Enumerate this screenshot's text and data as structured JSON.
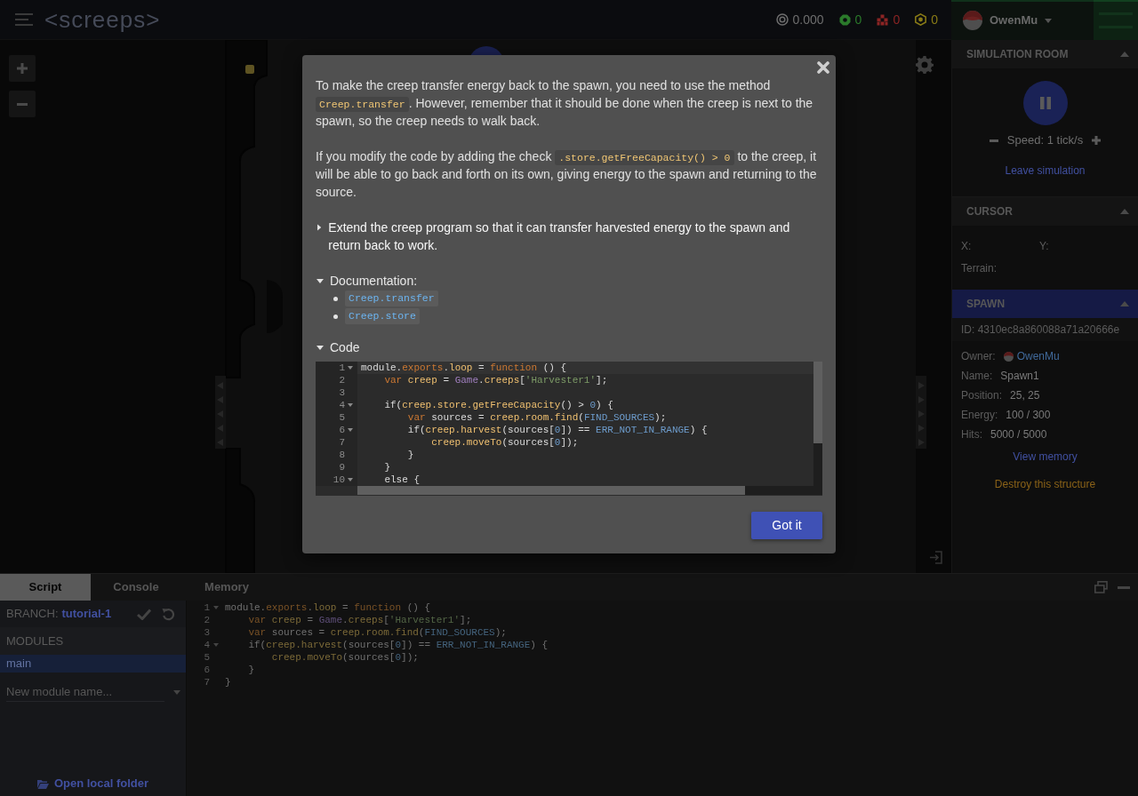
{
  "topbar": {
    "logo": "<screeps>",
    "stats": [
      {
        "kind": "credits",
        "value": "0.000",
        "color": "#6e6e6e"
      },
      {
        "kind": "gcl",
        "value": "0",
        "color": "#2b7a2b"
      },
      {
        "kind": "power",
        "value": "0",
        "color": "#8c2424"
      },
      {
        "kind": "energy",
        "value": "0",
        "color": "#8a7c16"
      }
    ],
    "user": {
      "name": "OwenMu"
    }
  },
  "side_panel": {
    "sections": [
      {
        "kind": "simulation",
        "title": "SIMULATION ROOM",
        "expanded": true,
        "active": false,
        "running": true,
        "speed": "Speed: 1 tick/s",
        "link": "Leave simulation"
      },
      {
        "kind": "cursor",
        "title": "CURSOR",
        "expanded": true,
        "active": false,
        "rows": [
          [
            "X:",
            "Y:"
          ],
          [
            "Terrain:"
          ]
        ]
      },
      {
        "kind": "object",
        "title": "SPAWN",
        "expanded": true,
        "active": true,
        "id": "ID: 4310ec8a860088a71a20666e",
        "fields": [
          {
            "kind": "user",
            "label": "Owner:",
            "value": "OwenMu"
          },
          {
            "kind": "text",
            "label": "Name:",
            "value": "Spawn1"
          },
          {
            "kind": "text",
            "label": "Position:",
            "value": "25, 25"
          },
          {
            "kind": "text",
            "label": "Energy:",
            "value": "100 / 300"
          },
          {
            "kind": "text",
            "label": "Hits:",
            "value": "5000 / 5000"
          }
        ],
        "links": [
          {
            "kind": "normal",
            "text": "View memory"
          },
          {
            "kind": "danger",
            "text": "Destroy this structure"
          }
        ]
      }
    ]
  },
  "bottom_panel": {
    "tabs": [
      {
        "label": "Script",
        "selected": true
      },
      {
        "label": "Console",
        "selected": false
      },
      {
        "label": "Memory",
        "selected": false
      }
    ],
    "branch": {
      "label": "BRANCH:",
      "name": "tutorial-1"
    },
    "modules": {
      "title": "MODULES",
      "items": [
        {
          "name": "main",
          "selected": true
        }
      ],
      "new_module": {
        "placeholder": "New module name..."
      }
    },
    "open_folder": "Open local folder",
    "editor": {
      "lines": [
        {
          "number": "1",
          "fold": true,
          "tokens": [
            {
              "kind": "plain",
              "text": "module."
            },
            {
              "kind": "keyword",
              "text": "exports"
            },
            {
              "kind": "plain",
              "text": "."
            },
            {
              "kind": "prop",
              "text": "loop"
            },
            {
              "kind": "plain",
              "text": " = "
            },
            {
              "kind": "keyword",
              "text": "function"
            },
            {
              "kind": "plain",
              "text": " () {"
            }
          ]
        },
        {
          "number": "2",
          "fold": false,
          "tokens": [
            {
              "kind": "keyword",
              "text": "    var "
            },
            {
              "kind": "prop",
              "text": "creep"
            },
            {
              "kind": "plain",
              "text": " = "
            },
            {
              "kind": "global",
              "text": "Game"
            },
            {
              "kind": "plain",
              "text": "."
            },
            {
              "kind": "prop",
              "text": "creeps"
            },
            {
              "kind": "plain",
              "text": "["
            },
            {
              "kind": "string",
              "text": "'Harvester1'"
            },
            {
              "kind": "plain",
              "text": "];"
            }
          ]
        },
        {
          "number": "3",
          "fold": false,
          "tokens": [
            {
              "kind": "keyword",
              "text": "    var"
            },
            {
              "kind": "plain",
              "text": " sources = "
            },
            {
              "kind": "prop",
              "text": "creep.room.find"
            },
            {
              "kind": "plain",
              "text": "("
            },
            {
              "kind": "const",
              "text": "FIND_SOURCES"
            },
            {
              "kind": "plain",
              "text": ");"
            }
          ]
        },
        {
          "number": "4",
          "fold": true,
          "tokens": [
            {
              "kind": "plain",
              "text": "    if("
            },
            {
              "kind": "prop",
              "text": "creep.harvest"
            },
            {
              "kind": "plain",
              "text": "(sources["
            },
            {
              "kind": "const",
              "text": "0"
            },
            {
              "kind": "plain",
              "text": "]) == "
            },
            {
              "kind": "const",
              "text": "ERR_NOT_IN_RANGE"
            },
            {
              "kind": "plain",
              "text": ") {"
            }
          ]
        },
        {
          "number": "5",
          "fold": false,
          "tokens": [
            {
              "kind": "prop",
              "text": "        creep.moveTo"
            },
            {
              "kind": "plain",
              "text": "(sources["
            },
            {
              "kind": "const",
              "text": "0"
            },
            {
              "kind": "plain",
              "text": "]);"
            }
          ]
        },
        {
          "number": "6",
          "fold": false,
          "tokens": [
            {
              "kind": "plain",
              "text": "    }"
            }
          ]
        },
        {
          "number": "7",
          "fold": false,
          "tokens": [
            {
              "kind": "plain",
              "text": "}"
            }
          ]
        }
      ]
    }
  },
  "modal": {
    "paragraphs": [
      [
        {
          "kind": "text",
          "text": "To make the creep transfer energy back to the spawn, you need to use the method "
        },
        {
          "kind": "code",
          "text": "Creep.transfer"
        },
        {
          "kind": "text",
          "text": ". However, remember that it should be done when the creep is next to the spawn, so the creep needs to walk back."
        }
      ],
      [
        {
          "kind": "text",
          "text": "If you modify the code by adding the check "
        },
        {
          "kind": "code",
          "text": ".store.getFreeCapacity() > 0"
        },
        {
          "kind": "text",
          "text": " to the creep, it will be able to go back and forth on its own, giving energy to the spawn and returning to the source."
        }
      ]
    ],
    "sections": [
      {
        "kind": "task",
        "label": "Extend the creep program so that it can transfer harvested energy to the spawn and return back to work.",
        "expanded": false
      },
      {
        "kind": "links",
        "label": "Documentation:",
        "expanded": true,
        "links": [
          "Creep.transfer",
          "Creep.store"
        ]
      },
      {
        "kind": "code",
        "label": "Code",
        "expanded": true,
        "lines": [
          {
            "number": "1",
            "fold": true,
            "current": true,
            "tokens": [
              {
                "kind": "plain",
                "text": "module."
              },
              {
                "kind": "keyword",
                "text": "exports"
              },
              {
                "kind": "plain",
                "text": "."
              },
              {
                "kind": "prop",
                "text": "loop"
              },
              {
                "kind": "plain",
                "text": " = "
              },
              {
                "kind": "keyword",
                "text": "function"
              },
              {
                "kind": "plain",
                "text": " () {"
              }
            ]
          },
          {
            "number": "2",
            "fold": false,
            "current": false,
            "tokens": [
              {
                "kind": "keyword",
                "text": "    var "
              },
              {
                "kind": "prop",
                "text": "creep"
              },
              {
                "kind": "plain",
                "text": " = "
              },
              {
                "kind": "global",
                "text": "Game"
              },
              {
                "kind": "plain",
                "text": "."
              },
              {
                "kind": "prop",
                "text": "creeps"
              },
              {
                "kind": "plain",
                "text": "["
              },
              {
                "kind": "string",
                "text": "'Harvester1'"
              },
              {
                "kind": "plain",
                "text": "];"
              }
            ]
          },
          {
            "number": "3",
            "fold": false,
            "current": false
          },
          {
            "number": "4",
            "fold": true,
            "current": false,
            "tokens": [
              {
                "kind": "plain",
                "text": "    if("
              },
              {
                "kind": "prop",
                "text": "creep.store.getFreeCapacity"
              },
              {
                "kind": "plain",
                "text": "() > "
              },
              {
                "kind": "const",
                "text": "0"
              },
              {
                "kind": "plain",
                "text": ") {"
              }
            ]
          },
          {
            "number": "5",
            "fold": false,
            "current": false,
            "tokens": [
              {
                "kind": "keyword",
                "text": "        var"
              },
              {
                "kind": "plain",
                "text": " sources = "
              },
              {
                "kind": "prop",
                "text": "creep.room.find"
              },
              {
                "kind": "plain",
                "text": "("
              },
              {
                "kind": "const",
                "text": "FIND_SOURCES"
              },
              {
                "kind": "plain",
                "text": ");"
              }
            ]
          },
          {
            "number": "6",
            "fold": true,
            "current": false,
            "tokens": [
              {
                "kind": "plain",
                "text": "        if("
              },
              {
                "kind": "prop",
                "text": "creep.harvest"
              },
              {
                "kind": "plain",
                "text": "(sources["
              },
              {
                "kind": "const",
                "text": "0"
              },
              {
                "kind": "plain",
                "text": "]) == "
              },
              {
                "kind": "const",
                "text": "ERR_NOT_IN_RANGE"
              },
              {
                "kind": "plain",
                "text": ") {"
              }
            ]
          },
          {
            "number": "7",
            "fold": false,
            "current": false,
            "tokens": [
              {
                "kind": "prop",
                "text": "            creep.moveTo"
              },
              {
                "kind": "plain",
                "text": "(sources["
              },
              {
                "kind": "const",
                "text": "0"
              },
              {
                "kind": "plain",
                "text": "]);"
              }
            ]
          },
          {
            "number": "8",
            "fold": false,
            "current": false,
            "tokens": [
              {
                "kind": "plain",
                "text": "        }"
              }
            ]
          },
          {
            "number": "9",
            "fold": false,
            "current": false,
            "tokens": [
              {
                "kind": "plain",
                "text": "    }"
              }
            ]
          },
          {
            "number": "10",
            "fold": true,
            "current": false,
            "tokens": [
              {
                "kind": "plain",
                "text": "    else {"
              }
            ]
          }
        ]
      }
    ],
    "button": "Got it"
  }
}
